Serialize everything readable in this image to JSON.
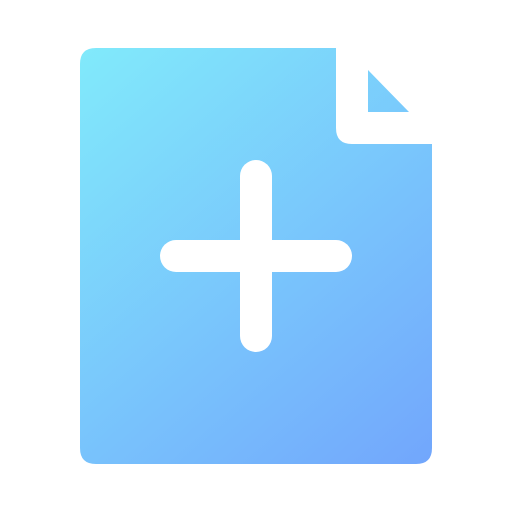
{
  "icon": {
    "name": "add-file-icon",
    "gradient_start": "#81EAFB",
    "gradient_end": "#72A6FC",
    "glyph_color": "#FFFFFF"
  }
}
